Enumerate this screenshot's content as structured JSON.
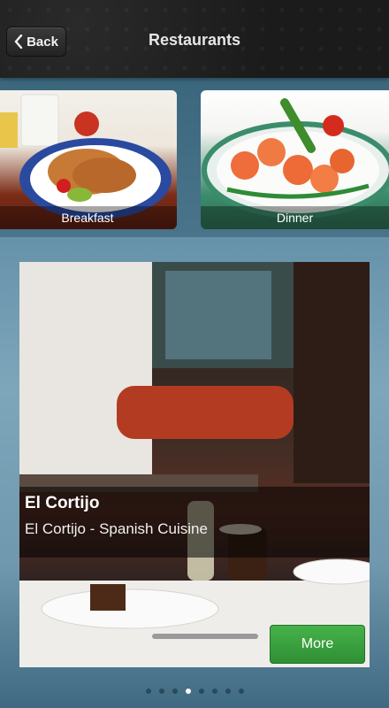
{
  "header": {
    "back_label": "Back",
    "title": "Restaurants"
  },
  "categories": [
    {
      "label": "Breakfast"
    },
    {
      "label": "Dinner"
    }
  ],
  "featured": {
    "name": "El Cortijo",
    "subtitle": "El Cortijo - Spanish Cuisine",
    "more_label": "More"
  },
  "pager": {
    "count": 8,
    "active_index": 3
  },
  "colors": {
    "more_button": "#3aa23f",
    "header_bg": "#1e1e1e"
  }
}
